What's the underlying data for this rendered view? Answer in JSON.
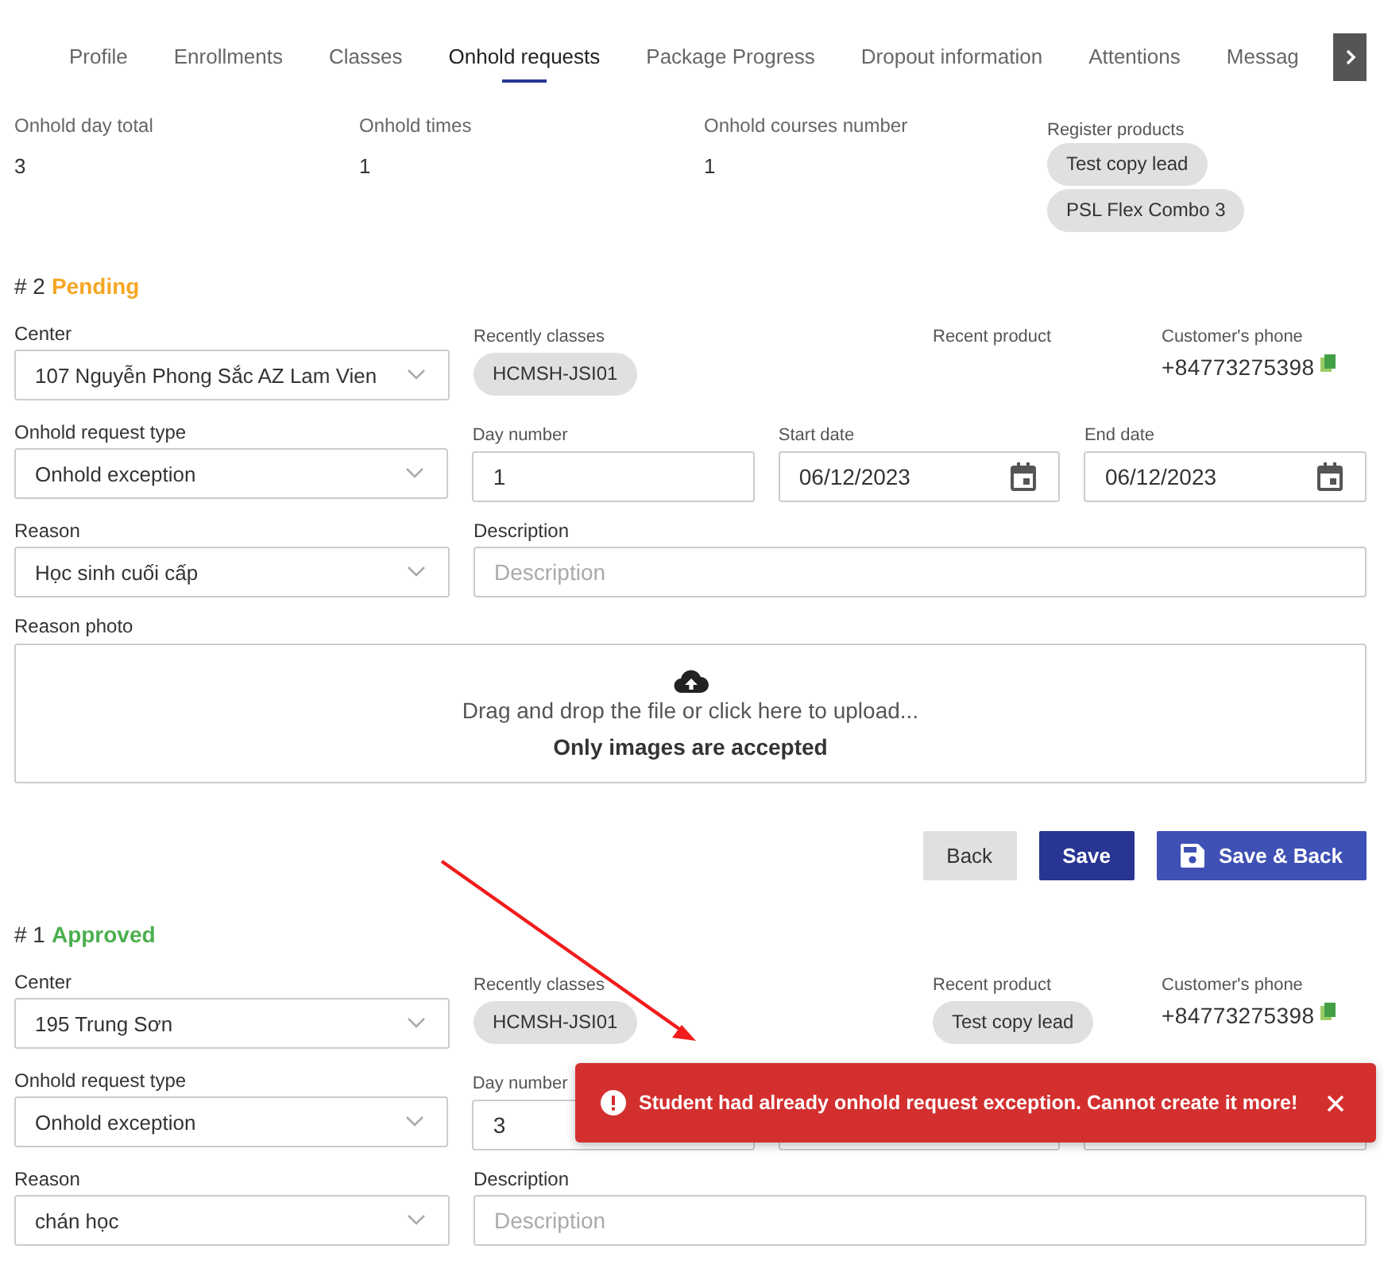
{
  "tabs": [
    {
      "label": "Profile",
      "selected": false
    },
    {
      "label": "Enrollments",
      "selected": false
    },
    {
      "label": "Classes",
      "selected": false
    },
    {
      "label": "Onhold requests",
      "selected": true
    },
    {
      "label": "Package Progress",
      "selected": false
    },
    {
      "label": "Dropout information",
      "selected": false
    },
    {
      "label": "Attentions",
      "selected": false
    },
    {
      "label": "Messag",
      "selected": false
    }
  ],
  "summary": [
    {
      "label": "Onhold day total",
      "value": "3"
    },
    {
      "label": "Onhold times",
      "value": "1"
    },
    {
      "label": "Onhold courses number",
      "value": "1"
    }
  ],
  "register_products": {
    "label": "Register products",
    "chips": [
      "Test copy lead",
      "PSL Flex Combo 3"
    ]
  },
  "requests": [
    {
      "number": "# 2",
      "status": "Pending",
      "color": "#f5a623",
      "center": {
        "label": "Center",
        "value": "107 Nguyễn Phong Sắc AZ Lam Vien"
      },
      "recently_classes": {
        "label": "Recently classes",
        "chips": [
          "HCMSH-JSI01"
        ]
      },
      "recent_product": {
        "label": "Recent product"
      },
      "phone": {
        "label": "Customer's phone",
        "value": "+84773275398"
      },
      "request_type": {
        "label": "Onhold request type",
        "value": "Onhold exception"
      },
      "day_number": {
        "label": "Day number",
        "value": "1"
      },
      "dates": [
        {
          "kind": "date",
          "label": "Start date",
          "value": "06/12/2023"
        },
        {
          "kind": "date",
          "label": "End date",
          "value": "06/12/2023"
        }
      ],
      "reason": {
        "label": "Reason",
        "value": "Học sinh cuối cấp"
      },
      "description": {
        "label": "Description",
        "placeholder": "Description"
      },
      "reason_photo": {
        "label": "Reason photo",
        "text": "Drag and drop the file or click here to upload...",
        "note": "Only images are accepted"
      },
      "buttons": [
        {
          "label": "Back",
          "kind": "plain"
        },
        {
          "label": "Save",
          "kind": "primary"
        },
        {
          "label": "Save & Back",
          "kind": "save"
        }
      ]
    },
    {
      "number": "# 1",
      "status": "Approved",
      "color": "#4caf50",
      "center": {
        "label": "Center",
        "value": "195 Trung Sơn"
      },
      "recently_classes": {
        "label": "Recently classes",
        "chips": [
          "HCMSH-JSI01"
        ]
      },
      "recent_product": {
        "label": "Recent product",
        "chips": [
          "Test copy lead"
        ]
      },
      "phone": {
        "label": "Customer's phone",
        "value": "+84773275398"
      },
      "request_type": {
        "label": "Onhold request type",
        "value": "Onhold exception"
      },
      "day_number": {
        "label": "Day number",
        "value": "3"
      },
      "dates": [
        {
          "kind": "date"
        },
        {
          "kind": "date"
        }
      ],
      "reason": {
        "label": "Reason",
        "value": "chán học"
      },
      "description": {
        "label": "Description",
        "placeholder": "Description"
      }
    }
  ],
  "toast": {
    "kind": "error",
    "message": "Student had already onhold request exception. Cannot create it more!"
  }
}
